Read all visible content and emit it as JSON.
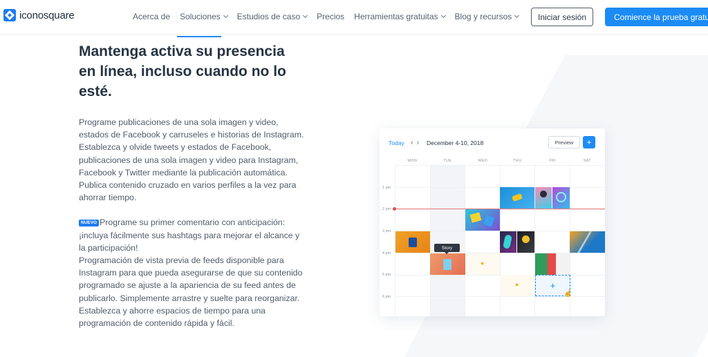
{
  "header": {
    "logo_text": "iconosquare",
    "nav": [
      {
        "label": "Acerca de",
        "dropdown": false
      },
      {
        "label": "Soluciones",
        "dropdown": true
      },
      {
        "label": "Estudios de caso",
        "dropdown": true
      },
      {
        "label": "Precios",
        "dropdown": false
      },
      {
        "label": "Herramientas gratuitas",
        "dropdown": true
      },
      {
        "label": "Blog y recursos",
        "dropdown": true
      }
    ],
    "login_label": "Iniciar sesión",
    "trial_label": "Comience la prueba gratuita",
    "accent_color": "#1b8bf5"
  },
  "main": {
    "headline": "Mantenga activa su presencia en línea, incluso cuando no lo esté.",
    "paragraph1": "Programe publicaciones de una sola imagen y video, estados de Facebook y carruseles e historias de Instagram.",
    "paragraph2": "Establezca y olvide tweets y estados de Facebook, publicaciones de una sola imagen y video para Instagram, Facebook y Twitter mediante la publicación automática.",
    "paragraph3": "Publica contenido cruzado en varios perfiles a la vez para ahorrar tiempo.",
    "badge": "NUEVO",
    "paragraph4": "Programe su primer comentario con anticipación: ¡incluya fácilmente sus hashtags para mejorar el alcance y la participación!",
    "paragraph5": "Programación de vista previa de feeds disponible para Instagram para que pueda asegurarse de que su contenido programado se ajuste a la apariencia de su feed antes de publicarlo. Simplemente arrastre y suelte para reorganizar.",
    "paragraph6": "Establezca y ahorre espacios de tiempo para una programación de contenido rápida y fácil."
  },
  "calendar": {
    "today_label": "Today",
    "date_range": "December 4-10, 2018",
    "preview_label": "Preview",
    "add_icon": "plus-icon",
    "days": [
      "MON",
      "TUE",
      "WED",
      "THU",
      "FRI",
      "SAT"
    ],
    "hours": [
      "1 pm",
      "2 pm",
      "3 pm",
      "4 pm",
      "5 pm",
      "6 pm"
    ],
    "story_label": "Story"
  }
}
